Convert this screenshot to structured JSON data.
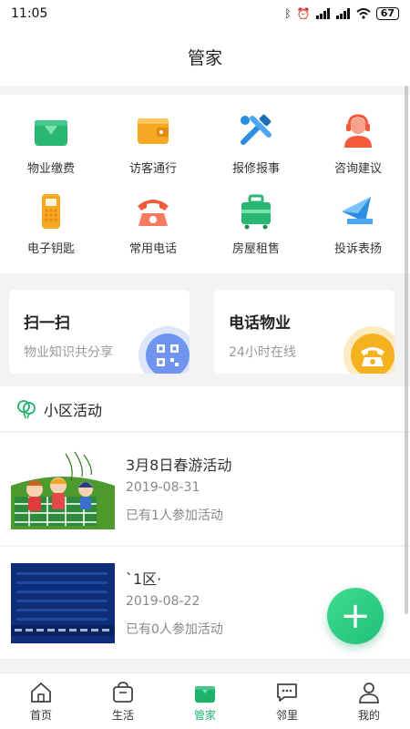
{
  "status_bar": {
    "time": "11:05",
    "battery": "67"
  },
  "header": {
    "title": "管家"
  },
  "services": [
    {
      "label": "物业缴费",
      "icon": "wallet-card-icon"
    },
    {
      "label": "访客通行",
      "icon": "wallet-icon"
    },
    {
      "label": "报修报事",
      "icon": "tools-icon"
    },
    {
      "label": "咨询建议",
      "icon": "support-agent-icon"
    },
    {
      "label": "电子钥匙",
      "icon": "key-pad-icon"
    },
    {
      "label": "常用电话",
      "icon": "telephone-icon"
    },
    {
      "label": "房屋租售",
      "icon": "suitcase-icon"
    },
    {
      "label": "投诉表扬",
      "icon": "envelope-icon"
    }
  ],
  "cards": {
    "scan": {
      "title": "扫一扫",
      "subtitle": "物业知识共分享",
      "icon": "qr-code-icon"
    },
    "phone": {
      "title": "电话物业",
      "subtitle": "24小时在线",
      "icon": "phone-icon"
    }
  },
  "activity_section": {
    "title": "小区活动",
    "icon": "balloons-icon"
  },
  "activities": [
    {
      "title": "3月8日春游活动",
      "date": "2019-08-31",
      "participants": "已有1人参加活动"
    },
    {
      "title": "`1区·",
      "date": "2019-08-22",
      "participants": "已有0人参加活动"
    }
  ],
  "fab": {
    "label": "+",
    "icon": "plus-icon"
  },
  "tabbar": [
    {
      "label": "首页",
      "icon": "home-icon"
    },
    {
      "label": "生活",
      "icon": "shopping-bag-icon"
    },
    {
      "label": "管家",
      "icon": "butler-icon",
      "active": true
    },
    {
      "label": "邻里",
      "icon": "chat-icon"
    },
    {
      "label": "我的",
      "icon": "user-icon"
    }
  ],
  "colors": {
    "accent": "#1eb36b",
    "background": "#f3f3f3"
  }
}
